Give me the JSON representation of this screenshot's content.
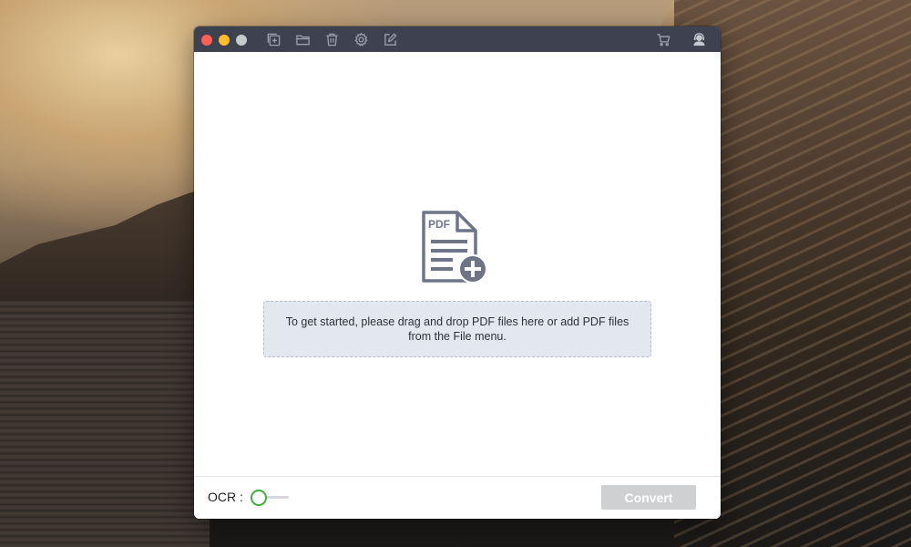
{
  "window": {
    "toolbar": {
      "left_icons": [
        "add-file-icon",
        "folder-icon",
        "trash-icon",
        "gear-icon",
        "edit-icon"
      ],
      "right_icons": [
        "cart-icon",
        "support-agent-icon"
      ]
    },
    "placeholder_graphic": {
      "badge_text": "PDF"
    },
    "drop_zone": {
      "message": "To get started, please drag and drop PDF files here or add PDF files from the File menu."
    },
    "footer": {
      "ocr_label": "OCR :",
      "ocr_enabled": false,
      "convert_label": "Convert",
      "convert_enabled": false
    }
  },
  "colors": {
    "titlebar": "#3e4150",
    "accent_green": "#3eae3a",
    "drop_zone_bg": "#e3e7ef",
    "icon_gray": "#6e7587"
  }
}
